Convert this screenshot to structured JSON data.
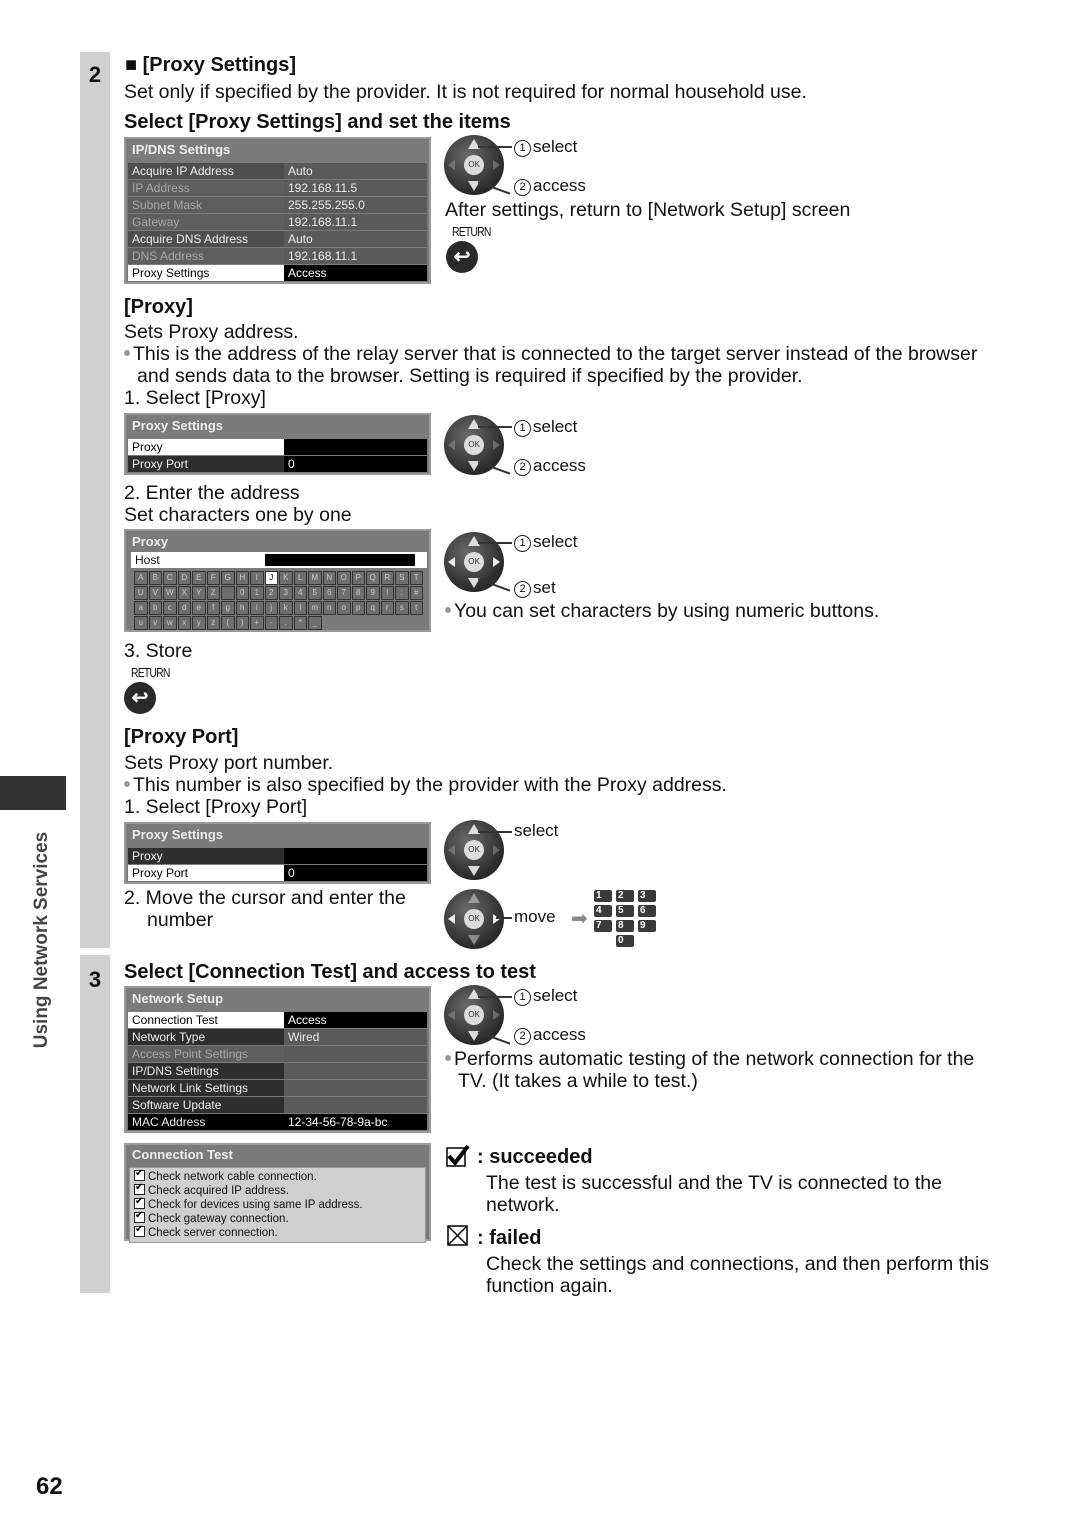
{
  "page_number": "62",
  "side_label": "Using Network Services",
  "step2": {
    "number": "2",
    "heading": "[Proxy Settings]",
    "intro": "Set only if specified by the provider. It is not required for normal household use.",
    "select_heading": "Select [Proxy Settings] and set the items",
    "ipdns_menu": {
      "title": "IP/DNS Settings",
      "rows": [
        {
          "label": "Acquire IP Address",
          "value": "Auto"
        },
        {
          "label": "IP Address",
          "value": "192.168.11.5"
        },
        {
          "label": "Subnet Mask",
          "value": "255.255.255.0"
        },
        {
          "label": "Gateway",
          "value": "192.168.11.1"
        },
        {
          "label": "Acquire DNS Address",
          "value": "Auto"
        },
        {
          "label": "DNS Address",
          "value": "192.168.11.1"
        },
        {
          "label": "Proxy Settings",
          "value": "Access"
        }
      ]
    },
    "remote1": {
      "select": "select",
      "access": "access",
      "n1": "1",
      "n2": "2"
    },
    "after_settings": "After settings, return to [Network Setup] screen",
    "return_label": "RETURN",
    "proxy": {
      "heading": "[Proxy]",
      "desc": "Sets Proxy address.",
      "bullet_line1": "This is the address of the relay server that is connected to the target server instead of the browser",
      "bullet_line2": "and sends data to the browser. Setting is required if specified by the provider.",
      "step1": "1. Select [Proxy]",
      "menu": {
        "title": "Proxy Settings",
        "rows": [
          {
            "label": "Proxy",
            "value": ""
          },
          {
            "label": "Proxy Port",
            "value": "0"
          }
        ]
      },
      "remote": {
        "select": "select",
        "access": "access"
      },
      "step2_line1": "2. Enter the address",
      "step2_line2": "Set characters one by one",
      "entry": {
        "title": "Proxy",
        "host_label": "Host",
        "keyboard_rows": [
          [
            "A",
            "B",
            "C",
            "D",
            "E",
            "F",
            "G",
            "H",
            "I",
            "J",
            "K",
            "L",
            "M",
            "N",
            "O",
            "P",
            "Q",
            "R",
            "S",
            "T"
          ],
          [
            "U",
            "V",
            "W",
            "X",
            "Y",
            "Z",
            "",
            "0",
            "1",
            "2",
            "3",
            "4",
            "5",
            "6",
            "7",
            "8",
            "9",
            "!",
            ":",
            "#"
          ],
          [
            "a",
            "b",
            "c",
            "d",
            "e",
            "f",
            "g",
            "h",
            "i",
            "j",
            "k",
            "l",
            "m",
            "n",
            "o",
            "p",
            "q",
            "r",
            "s",
            "t"
          ],
          [
            "u",
            "v",
            "w",
            "x",
            "y",
            "z",
            "(",
            ")",
            "+",
            "-",
            ".",
            "*",
            "_"
          ]
        ],
        "selected_key": "J"
      },
      "remote2": {
        "select": "select",
        "set": "set"
      },
      "numeric_note": "You can set characters by using numeric buttons.",
      "step3": "3. Store"
    },
    "proxy_port": {
      "heading": "[Proxy Port]",
      "desc": "Sets Proxy port number.",
      "bullet": "This number is also specified by the provider with the Proxy address.",
      "step1": "1. Select [Proxy Port]",
      "menu": {
        "title": "Proxy Settings",
        "rows": [
          {
            "label": "Proxy",
            "value": ""
          },
          {
            "label": "Proxy Port",
            "value": "0"
          }
        ]
      },
      "select_label": "select",
      "step2_line1": "2. Move the cursor and enter the",
      "step2_line2": "number",
      "move_label": "move",
      "number_keys": [
        "1",
        "2",
        "3",
        "4",
        "5",
        "6",
        "7",
        "8",
        "9",
        "0"
      ]
    }
  },
  "step3": {
    "number": "3",
    "heading": "Select [Connection Test] and access to test",
    "network_menu": {
      "title": "Network Setup",
      "rows": [
        {
          "label": "Connection Test",
          "value": "Access"
        },
        {
          "label": "Network Type",
          "value": "Wired"
        },
        {
          "label": "Access Point Settings",
          "value": ""
        },
        {
          "label": "IP/DNS Settings",
          "value": ""
        },
        {
          "label": "Network Link Settings",
          "value": ""
        },
        {
          "label": "Software Update",
          "value": ""
        },
        {
          "label": "MAC Address",
          "value": "12-34-56-78-9a-bc"
        }
      ]
    },
    "remote": {
      "select": "select",
      "access": "access"
    },
    "note_line1": "Performs automatic testing of the network connection for the",
    "note_line2": "TV. (It takes a while to test.)",
    "connection_test": {
      "title": "Connection Test",
      "checks": [
        "Check network cable connection.",
        "Check acquired IP address.",
        "Check for devices using same IP address.",
        "Check gateway connection.",
        "Check server connection."
      ]
    },
    "succeeded": {
      "label": ": succeeded",
      "line1": "The test is successful and the TV is connected to the",
      "line2": "network."
    },
    "failed": {
      "label": ": failed",
      "line1": "Check the settings and connections, and then perform this",
      "line2": "function again."
    }
  }
}
